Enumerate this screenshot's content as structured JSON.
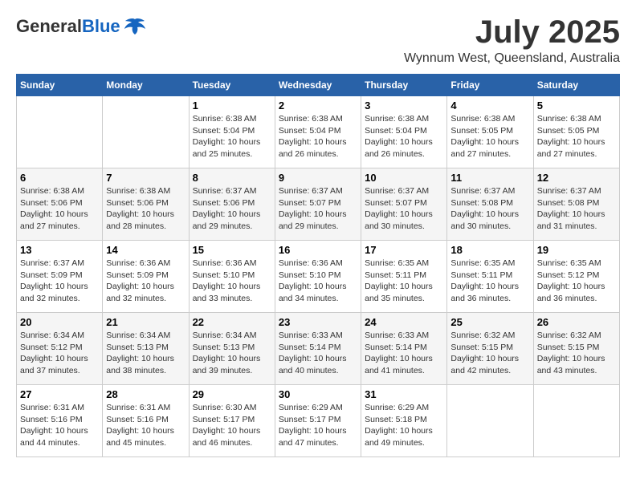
{
  "header": {
    "logo_general": "General",
    "logo_blue": "Blue",
    "month_year": "July 2025",
    "location": "Wynnum West, Queensland, Australia"
  },
  "calendar": {
    "days_of_week": [
      "Sunday",
      "Monday",
      "Tuesday",
      "Wednesday",
      "Thursday",
      "Friday",
      "Saturday"
    ],
    "weeks": [
      [
        {
          "day": "",
          "info": ""
        },
        {
          "day": "",
          "info": ""
        },
        {
          "day": "1",
          "info": "Sunrise: 6:38 AM\nSunset: 5:04 PM\nDaylight: 10 hours\nand 25 minutes."
        },
        {
          "day": "2",
          "info": "Sunrise: 6:38 AM\nSunset: 5:04 PM\nDaylight: 10 hours\nand 26 minutes."
        },
        {
          "day": "3",
          "info": "Sunrise: 6:38 AM\nSunset: 5:04 PM\nDaylight: 10 hours\nand 26 minutes."
        },
        {
          "day": "4",
          "info": "Sunrise: 6:38 AM\nSunset: 5:05 PM\nDaylight: 10 hours\nand 27 minutes."
        },
        {
          "day": "5",
          "info": "Sunrise: 6:38 AM\nSunset: 5:05 PM\nDaylight: 10 hours\nand 27 minutes."
        }
      ],
      [
        {
          "day": "6",
          "info": "Sunrise: 6:38 AM\nSunset: 5:06 PM\nDaylight: 10 hours\nand 27 minutes."
        },
        {
          "day": "7",
          "info": "Sunrise: 6:38 AM\nSunset: 5:06 PM\nDaylight: 10 hours\nand 28 minutes."
        },
        {
          "day": "8",
          "info": "Sunrise: 6:37 AM\nSunset: 5:06 PM\nDaylight: 10 hours\nand 29 minutes."
        },
        {
          "day": "9",
          "info": "Sunrise: 6:37 AM\nSunset: 5:07 PM\nDaylight: 10 hours\nand 29 minutes."
        },
        {
          "day": "10",
          "info": "Sunrise: 6:37 AM\nSunset: 5:07 PM\nDaylight: 10 hours\nand 30 minutes."
        },
        {
          "day": "11",
          "info": "Sunrise: 6:37 AM\nSunset: 5:08 PM\nDaylight: 10 hours\nand 30 minutes."
        },
        {
          "day": "12",
          "info": "Sunrise: 6:37 AM\nSunset: 5:08 PM\nDaylight: 10 hours\nand 31 minutes."
        }
      ],
      [
        {
          "day": "13",
          "info": "Sunrise: 6:37 AM\nSunset: 5:09 PM\nDaylight: 10 hours\nand 32 minutes."
        },
        {
          "day": "14",
          "info": "Sunrise: 6:36 AM\nSunset: 5:09 PM\nDaylight: 10 hours\nand 32 minutes."
        },
        {
          "day": "15",
          "info": "Sunrise: 6:36 AM\nSunset: 5:10 PM\nDaylight: 10 hours\nand 33 minutes."
        },
        {
          "day": "16",
          "info": "Sunrise: 6:36 AM\nSunset: 5:10 PM\nDaylight: 10 hours\nand 34 minutes."
        },
        {
          "day": "17",
          "info": "Sunrise: 6:35 AM\nSunset: 5:11 PM\nDaylight: 10 hours\nand 35 minutes."
        },
        {
          "day": "18",
          "info": "Sunrise: 6:35 AM\nSunset: 5:11 PM\nDaylight: 10 hours\nand 36 minutes."
        },
        {
          "day": "19",
          "info": "Sunrise: 6:35 AM\nSunset: 5:12 PM\nDaylight: 10 hours\nand 36 minutes."
        }
      ],
      [
        {
          "day": "20",
          "info": "Sunrise: 6:34 AM\nSunset: 5:12 PM\nDaylight: 10 hours\nand 37 minutes."
        },
        {
          "day": "21",
          "info": "Sunrise: 6:34 AM\nSunset: 5:13 PM\nDaylight: 10 hours\nand 38 minutes."
        },
        {
          "day": "22",
          "info": "Sunrise: 6:34 AM\nSunset: 5:13 PM\nDaylight: 10 hours\nand 39 minutes."
        },
        {
          "day": "23",
          "info": "Sunrise: 6:33 AM\nSunset: 5:14 PM\nDaylight: 10 hours\nand 40 minutes."
        },
        {
          "day": "24",
          "info": "Sunrise: 6:33 AM\nSunset: 5:14 PM\nDaylight: 10 hours\nand 41 minutes."
        },
        {
          "day": "25",
          "info": "Sunrise: 6:32 AM\nSunset: 5:15 PM\nDaylight: 10 hours\nand 42 minutes."
        },
        {
          "day": "26",
          "info": "Sunrise: 6:32 AM\nSunset: 5:15 PM\nDaylight: 10 hours\nand 43 minutes."
        }
      ],
      [
        {
          "day": "27",
          "info": "Sunrise: 6:31 AM\nSunset: 5:16 PM\nDaylight: 10 hours\nand 44 minutes."
        },
        {
          "day": "28",
          "info": "Sunrise: 6:31 AM\nSunset: 5:16 PM\nDaylight: 10 hours\nand 45 minutes."
        },
        {
          "day": "29",
          "info": "Sunrise: 6:30 AM\nSunset: 5:17 PM\nDaylight: 10 hours\nand 46 minutes."
        },
        {
          "day": "30",
          "info": "Sunrise: 6:29 AM\nSunset: 5:17 PM\nDaylight: 10 hours\nand 47 minutes."
        },
        {
          "day": "31",
          "info": "Sunrise: 6:29 AM\nSunset: 5:18 PM\nDaylight: 10 hours\nand 49 minutes."
        },
        {
          "day": "",
          "info": ""
        },
        {
          "day": "",
          "info": ""
        }
      ]
    ]
  }
}
